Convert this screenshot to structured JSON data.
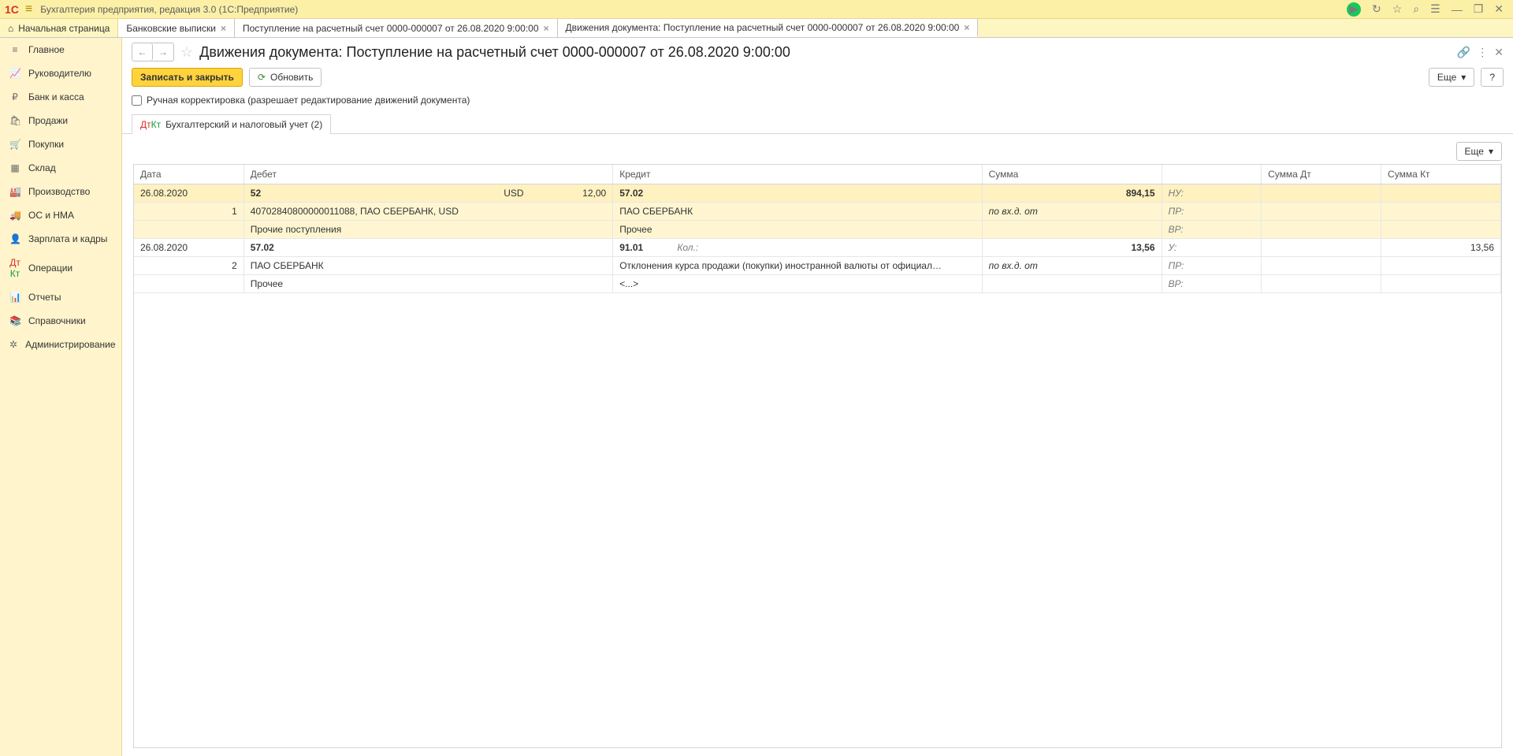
{
  "app": {
    "logo": "1С",
    "title": "Бухгалтерия предприятия, редакция 3.0  (1С:Предприятие)"
  },
  "top_tabs": {
    "home_label": "Начальная страница",
    "items": [
      {
        "label": "Банковские выписки"
      },
      {
        "label": "Поступление на расчетный счет 0000-000007 от 26.08.2020 9:00:00"
      },
      {
        "label": "Движения документа: Поступление на расчетный счет 0000-000007 от 26.08.2020 9:00:00",
        "active": true
      }
    ]
  },
  "sidebar": {
    "items": [
      {
        "icon": "≡",
        "label": "Главное"
      },
      {
        "icon": "📈",
        "label": "Руководителю"
      },
      {
        "icon": "₽",
        "label": "Банк и касса"
      },
      {
        "icon": "🛍",
        "label": "Продажи"
      },
      {
        "icon": "🛒",
        "label": "Покупки"
      },
      {
        "icon": "▦",
        "label": "Склад"
      },
      {
        "icon": "🏭",
        "label": "Производство"
      },
      {
        "icon": "🚚",
        "label": "ОС и НМА"
      },
      {
        "icon": "👤",
        "label": "Зарплата и кадры"
      },
      {
        "icon": "Дт",
        "label": "Операции"
      },
      {
        "icon": "📊",
        "label": "Отчеты"
      },
      {
        "icon": "📚",
        "label": "Справочники"
      },
      {
        "icon": "✲",
        "label": "Администрирование"
      }
    ]
  },
  "doc": {
    "title": "Движения документа: Поступление на расчетный счет 0000-000007 от 26.08.2020 9:00:00",
    "save_close": "Записать и закрыть",
    "refresh": "Обновить",
    "more": "Еще",
    "help": "?",
    "manual_edit": "Ручная корректировка (разрешает редактирование движений документа)"
  },
  "inner_tab": {
    "label": "Бухгалтерский и налоговый учет (2)"
  },
  "table": {
    "more": "Еще",
    "headers": {
      "date": "Дата",
      "debit": "Дебет",
      "credit": "Кредит",
      "sum": "Сумма",
      "sum_dt": "Сумма Дт",
      "sum_kt": "Сумма Кт"
    },
    "rows": [
      {
        "selected": true,
        "line1": {
          "date": "26.08.2020",
          "debit_acc": "52",
          "debit_cur": "USD",
          "debit_qty": "12,00",
          "credit_acc": "57.02",
          "sum": "894,15",
          "reg": "НУ:"
        },
        "line2": {
          "n": "1",
          "debit": "40702840800000011088, ПАО СБЕРБАНК, USD",
          "credit": "ПАО СБЕРБАНК",
          "sum": "по вх.д.   от",
          "reg": "ПР:"
        },
        "line3": {
          "debit": "Прочие поступления",
          "credit": "Прочее",
          "reg": "ВР:"
        }
      },
      {
        "selected": false,
        "line1": {
          "date": "26.08.2020",
          "debit_acc": "57.02",
          "credit_acc": "91.01",
          "credit_kol": "Кол.:",
          "sum": "13,56",
          "sum_highlight": true,
          "reg": "У:",
          "sum_kt": "13,56"
        },
        "line2": {
          "n": "2",
          "debit": "ПАО СБЕРБАНК",
          "credit": "Отклонения курса продажи (покупки) иностранной валюты от официал…",
          "sum": "по вх.д.   от",
          "reg": "ПР:"
        },
        "line3": {
          "debit": "Прочее",
          "credit": "<...>",
          "reg": "ВР:"
        }
      }
    ]
  }
}
